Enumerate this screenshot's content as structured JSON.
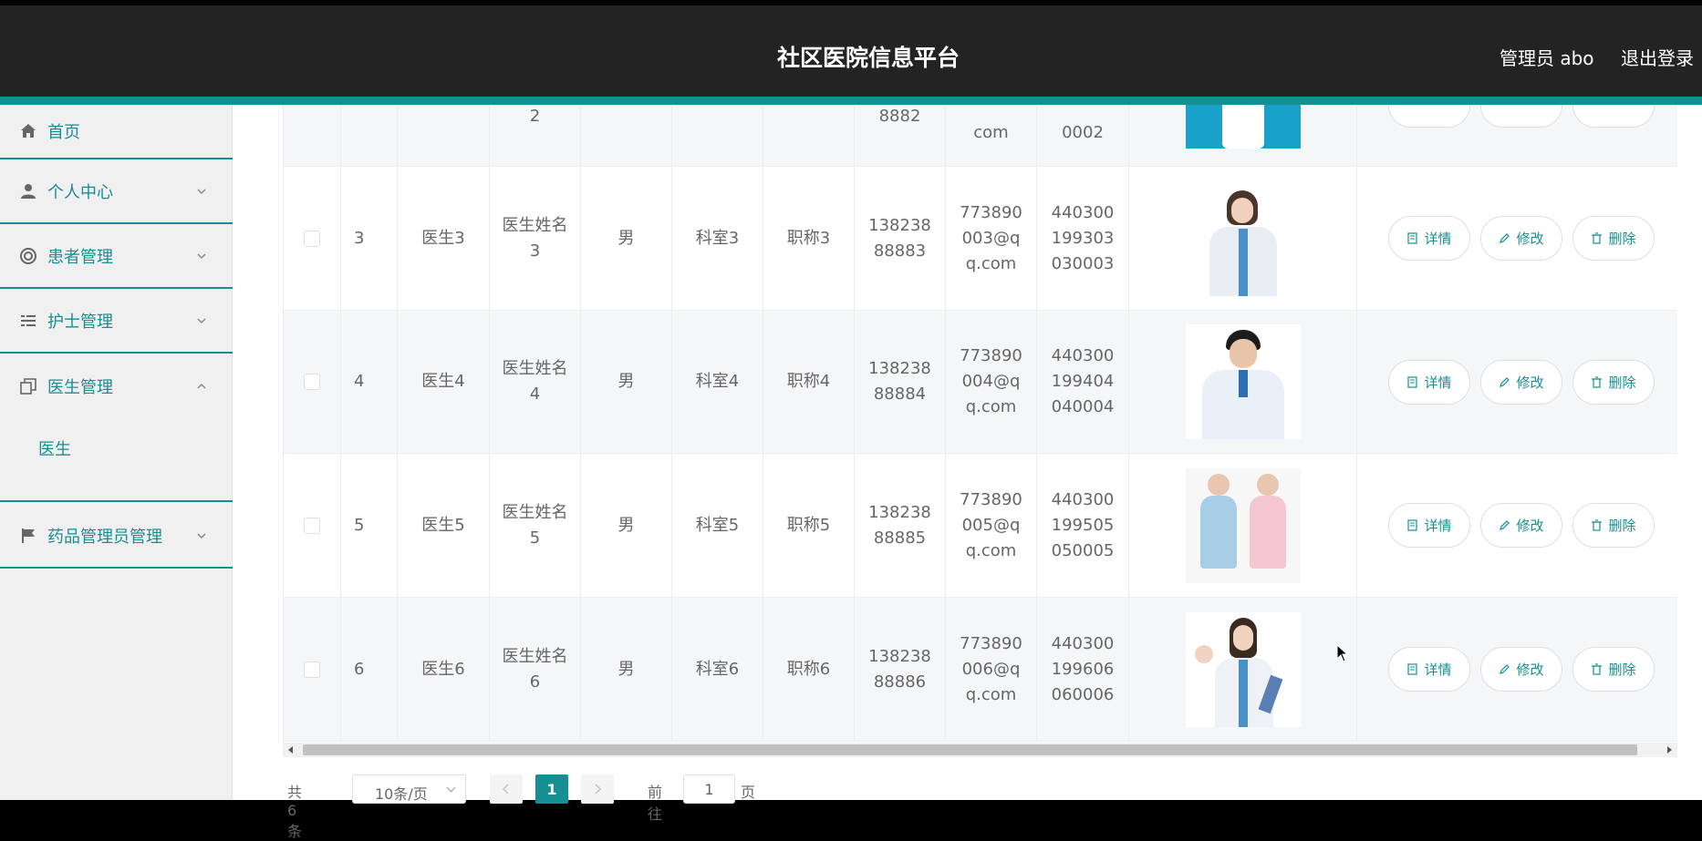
{
  "header": {
    "title": "社区医院信息平台",
    "user": "管理员 abo",
    "logout": "退出登录"
  },
  "sidebar": {
    "items": [
      {
        "label": "首页",
        "icon": "home-icon"
      },
      {
        "label": "个人中心",
        "icon": "user-icon"
      },
      {
        "label": "患者管理",
        "icon": "lifebuoy-icon"
      },
      {
        "label": "护士管理",
        "icon": "list-icon"
      },
      {
        "label": "医生管理",
        "icon": "copy-icon",
        "expanded": true
      },
      {
        "label": "药品管理员管理",
        "icon": "flag-icon"
      }
    ],
    "sub_item": "医生"
  },
  "table": {
    "partial_row": {
      "name_line": "2",
      "phone_tail": "8882",
      "email_tail": "com",
      "id_tail": "0002"
    },
    "rows": [
      {
        "id": "3",
        "account": "医生3",
        "name": "医生姓名3",
        "gender": "男",
        "dept": "科室3",
        "title": "职称3",
        "phone": "13823888883",
        "email": "773890003@qq.com",
        "idcard": "440300199303030003"
      },
      {
        "id": "4",
        "account": "医生4",
        "name": "医生姓名4",
        "gender": "男",
        "dept": "科室4",
        "title": "职称4",
        "phone": "13823888884",
        "email": "773890004@qq.com",
        "idcard": "440300199404040004"
      },
      {
        "id": "5",
        "account": "医生5",
        "name": "医生姓名5",
        "gender": "男",
        "dept": "科室5",
        "title": "职称5",
        "phone": "13823888885",
        "email": "773890005@qq.com",
        "idcard": "440300199505050005"
      },
      {
        "id": "6",
        "account": "医生6",
        "name": "医生姓名6",
        "gender": "男",
        "dept": "科室6",
        "title": "职称6",
        "phone": "13823888886",
        "email": "773890006@qq.com",
        "idcard": "440300199606060006"
      }
    ],
    "actions": {
      "detail": "详情",
      "edit": "修改",
      "delete": "删除"
    }
  },
  "pagination": {
    "total": "共 6 条",
    "page_size": "10条/页",
    "current": "1",
    "goto_label": "前往",
    "goto_value": "1",
    "page_unit": "页"
  },
  "colors": {
    "accent": "#168f92",
    "header_bg": "#232323"
  }
}
